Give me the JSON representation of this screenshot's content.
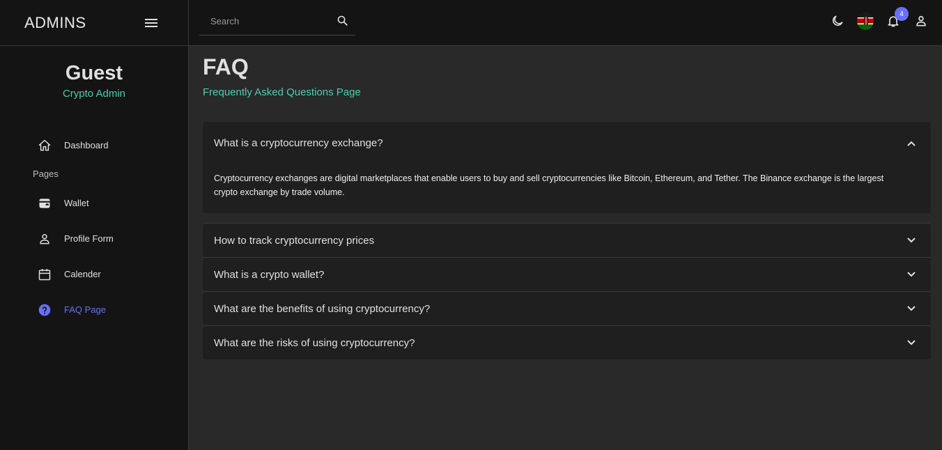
{
  "sidebar": {
    "brand": "ADMINS",
    "profile": {
      "name": "Guest",
      "role": "Crypto Admin"
    },
    "section_label": "Pages",
    "items": [
      {
        "label": "Dashboard",
        "icon": "home-icon"
      },
      {
        "label": "Wallet",
        "icon": "wallet-icon"
      },
      {
        "label": "Profile Form",
        "icon": "person-icon"
      },
      {
        "label": "Calender",
        "icon": "calendar-icon"
      },
      {
        "label": "FAQ Page",
        "icon": "help-circle-icon",
        "active": true
      }
    ]
  },
  "topbar": {
    "search_placeholder": "Search",
    "notification_count": "4"
  },
  "main": {
    "title": "FAQ",
    "subtitle": "Frequently Asked Questions Page",
    "faqs": [
      {
        "question": "What is a cryptocurrency exchange?",
        "answer": "Cryptocurrency exchanges are digital marketplaces that enable users to buy and sell cryptocurrencies like Bitcoin, Ethereum, and Tether. The Binance exchange is the largest crypto exchange by trade volume.",
        "expanded": true
      },
      {
        "question": "How to track cryptocurrency prices",
        "expanded": false
      },
      {
        "question": "What is a crypto wallet?",
        "expanded": false
      },
      {
        "question": "What are the benefits of using cryptocurrency?",
        "expanded": false
      },
      {
        "question": "What are the risks of using cryptocurrency?",
        "expanded": false
      }
    ]
  },
  "colors": {
    "accent_green": "#4cceac",
    "accent_purple": "#6870fa",
    "background": "#292929",
    "panel": "#141414",
    "card": "#1f1f1f"
  }
}
